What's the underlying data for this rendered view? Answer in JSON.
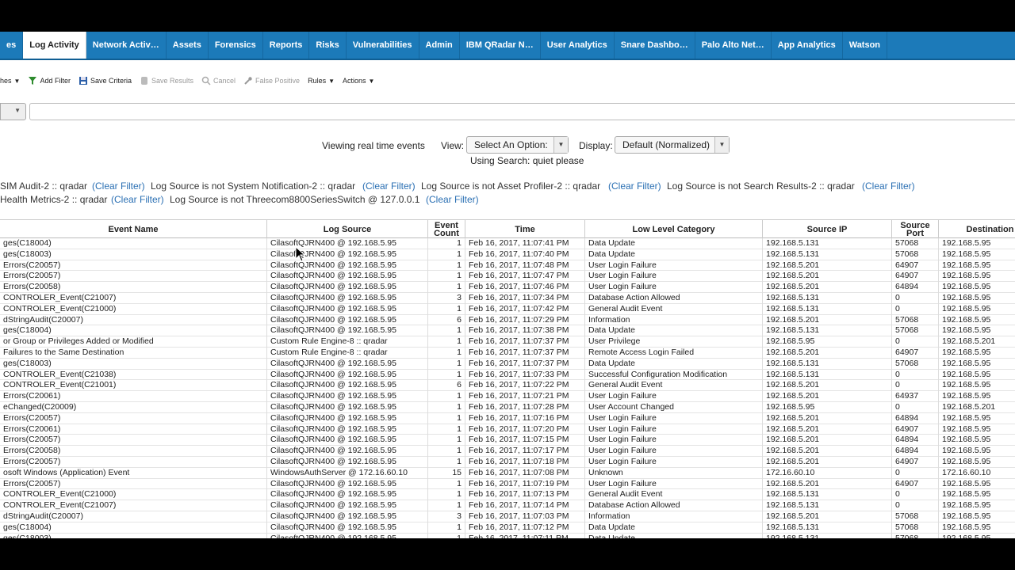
{
  "tabs": [
    {
      "label": "es",
      "active": false
    },
    {
      "label": "Log Activity",
      "active": true
    },
    {
      "label": "Network Activ…",
      "active": false
    },
    {
      "label": "Assets",
      "active": false
    },
    {
      "label": "Forensics",
      "active": false
    },
    {
      "label": "Reports",
      "active": false
    },
    {
      "label": "Risks",
      "active": false
    },
    {
      "label": "Vulnerabilities",
      "active": false
    },
    {
      "label": "Admin",
      "active": false
    },
    {
      "label": "IBM QRadar N…",
      "active": false
    },
    {
      "label": "User Analytics",
      "active": false
    },
    {
      "label": "Snare Dashbo…",
      "active": false
    },
    {
      "label": "Palo Alto Net…",
      "active": false
    },
    {
      "label": "App Analytics",
      "active": false
    },
    {
      "label": "Watson",
      "active": false
    }
  ],
  "toolbar": {
    "searches": "hes",
    "add_filter": "Add Filter",
    "save_criteria": "Save Criteria",
    "save_results": "Save Results",
    "cancel": "Cancel",
    "false_positive": "False Positive",
    "rules": "Rules",
    "actions": "Actions"
  },
  "search": {
    "value": ""
  },
  "view_bar": {
    "viewing": "Viewing real time events",
    "view_label": "View:",
    "view_value": "Select An Option:",
    "display_label": "Display:",
    "display_value": "Default (Normalized)",
    "using_search": "Using Search: quiet please"
  },
  "filters": {
    "row1": [
      {
        "text": "SIM Audit-2 :: qradar"
      },
      {
        "text": "(Clear Filter)"
      },
      {
        "text": "Log Source is not System Notification-2 :: qradar"
      },
      {
        "text": "(Clear Filter)"
      },
      {
        "text": "Log Source is not Asset Profiler-2 :: qradar"
      },
      {
        "text": "(Clear Filter)"
      },
      {
        "text": "Log Source is not Search Results-2 :: qradar"
      },
      {
        "text": "(Clear Filter)"
      }
    ],
    "row2": [
      {
        "text": "Health Metrics-2 :: qradar"
      },
      {
        "text": "(Clear Filter)"
      },
      {
        "text": "Log Source is not Threecom8800SeriesSwitch @ 127.0.0.1"
      },
      {
        "text": "(Clear Filter)"
      }
    ]
  },
  "table": {
    "headers": {
      "event_name": "Event Name",
      "log_source": "Log Source",
      "event_count": "Event Count",
      "time": "Time",
      "category": "Low Level Category",
      "source_ip": "Source IP",
      "source_port": "Source Port",
      "destination": "Destination"
    },
    "rows": [
      {
        "name": "ges(C18004)",
        "src": "CilasoftQJRN400 @ 192.168.5.95",
        "count": "1",
        "time": "Feb 16, 2017, 11:07:41 PM",
        "cat": "Data Update",
        "ip": "192.168.5.131",
        "port": "57068",
        "dst": "192.168.5.95"
      },
      {
        "name": "ges(C18003)",
        "src": "CilasoftQJRN400 @ 192.168.5.95",
        "count": "1",
        "time": "Feb 16, 2017, 11:07:40 PM",
        "cat": "Data Update",
        "ip": "192.168.5.131",
        "port": "57068",
        "dst": "192.168.5.95"
      },
      {
        "name": "Errors(C20057)",
        "src": "CilasoftQJRN400 @ 192.168.5.95",
        "count": "1",
        "time": "Feb 16, 2017, 11:07:48 PM",
        "cat": "User Login Failure",
        "ip": "192.168.5.201",
        "port": "64907",
        "dst": "192.168.5.95"
      },
      {
        "name": "Errors(C20057)",
        "src": "CilasoftQJRN400 @ 192.168.5.95",
        "count": "1",
        "time": "Feb 16, 2017, 11:07:47 PM",
        "cat": "User Login Failure",
        "ip": "192.168.5.201",
        "port": "64907",
        "dst": "192.168.5.95"
      },
      {
        "name": "Errors(C20058)",
        "src": "CilasoftQJRN400 @ 192.168.5.95",
        "count": "1",
        "time": "Feb 16, 2017, 11:07:46 PM",
        "cat": "User Login Failure",
        "ip": "192.168.5.201",
        "port": "64894",
        "dst": "192.168.5.95"
      },
      {
        "name": "CONTROLER_Event(C21007)",
        "src": "CilasoftQJRN400 @ 192.168.5.95",
        "count": "3",
        "time": "Feb 16, 2017, 11:07:34 PM",
        "cat": "Database Action Allowed",
        "ip": "192.168.5.131",
        "port": "0",
        "dst": "192.168.5.95"
      },
      {
        "name": "CONTROLER_Event(C21000)",
        "src": "CilasoftQJRN400 @ 192.168.5.95",
        "count": "1",
        "time": "Feb 16, 2017, 11:07:42 PM",
        "cat": "General Audit Event",
        "ip": "192.168.5.131",
        "port": "0",
        "dst": "192.168.5.95"
      },
      {
        "name": "dStringAudit(C20007)",
        "src": "CilasoftQJRN400 @ 192.168.5.95",
        "count": "6",
        "time": "Feb 16, 2017, 11:07:29 PM",
        "cat": "Information",
        "ip": "192.168.5.201",
        "port": "57068",
        "dst": "192.168.5.95"
      },
      {
        "name": "ges(C18004)",
        "src": "CilasoftQJRN400 @ 192.168.5.95",
        "count": "1",
        "time": "Feb 16, 2017, 11:07:38 PM",
        "cat": "Data Update",
        "ip": "192.168.5.131",
        "port": "57068",
        "dst": "192.168.5.95"
      },
      {
        "name": "or Group or Privileges Added or Modified",
        "src": "Custom Rule Engine-8 :: qradar",
        "count": "1",
        "time": "Feb 16, 2017, 11:07:37 PM",
        "cat": "User Privilege",
        "ip": "192.168.5.95",
        "port": "0",
        "dst": "192.168.5.201"
      },
      {
        "name": "Failures to the Same Destination",
        "src": "Custom Rule Engine-8 :: qradar",
        "count": "1",
        "time": "Feb 16, 2017, 11:07:37 PM",
        "cat": "Remote Access Login Failed",
        "ip": "192.168.5.201",
        "port": "64907",
        "dst": "192.168.5.95"
      },
      {
        "name": "ges(C18003)",
        "src": "CilasoftQJRN400 @ 192.168.5.95",
        "count": "1",
        "time": "Feb 16, 2017, 11:07:37 PM",
        "cat": "Data Update",
        "ip": "192.168.5.131",
        "port": "57068",
        "dst": "192.168.5.95"
      },
      {
        "name": "CONTROLER_Event(C21038)",
        "src": "CilasoftQJRN400 @ 192.168.5.95",
        "count": "1",
        "time": "Feb 16, 2017, 11:07:33 PM",
        "cat": "Successful Configuration Modification",
        "ip": "192.168.5.131",
        "port": "0",
        "dst": "192.168.5.95"
      },
      {
        "name": "CONTROLER_Event(C21001)",
        "src": "CilasoftQJRN400 @ 192.168.5.95",
        "count": "6",
        "time": "Feb 16, 2017, 11:07:22 PM",
        "cat": "General Audit Event",
        "ip": "192.168.5.201",
        "port": "0",
        "dst": "192.168.5.95"
      },
      {
        "name": "Errors(C20061)",
        "src": "CilasoftQJRN400 @ 192.168.5.95",
        "count": "1",
        "time": "Feb 16, 2017, 11:07:21 PM",
        "cat": "User Login Failure",
        "ip": "192.168.5.201",
        "port": "64937",
        "dst": "192.168.5.95"
      },
      {
        "name": "eChanged(C20009)",
        "src": "CilasoftQJRN400 @ 192.168.5.95",
        "count": "1",
        "time": "Feb 16, 2017, 11:07:28 PM",
        "cat": "User Account Changed",
        "ip": "192.168.5.95",
        "port": "0",
        "dst": "192.168.5.201"
      },
      {
        "name": "Errors(C20057)",
        "src": "CilasoftQJRN400 @ 192.168.5.95",
        "count": "1",
        "time": "Feb 16, 2017, 11:07:16 PM",
        "cat": "User Login Failure",
        "ip": "192.168.5.201",
        "port": "64894",
        "dst": "192.168.5.95"
      },
      {
        "name": "Errors(C20061)",
        "src": "CilasoftQJRN400 @ 192.168.5.95",
        "count": "1",
        "time": "Feb 16, 2017, 11:07:20 PM",
        "cat": "User Login Failure",
        "ip": "192.168.5.201",
        "port": "64907",
        "dst": "192.168.5.95"
      },
      {
        "name": "Errors(C20057)",
        "src": "CilasoftQJRN400 @ 192.168.5.95",
        "count": "1",
        "time": "Feb 16, 2017, 11:07:15 PM",
        "cat": "User Login Failure",
        "ip": "192.168.5.201",
        "port": "64894",
        "dst": "192.168.5.95"
      },
      {
        "name": "Errors(C20058)",
        "src": "CilasoftQJRN400 @ 192.168.5.95",
        "count": "1",
        "time": "Feb 16, 2017, 11:07:17 PM",
        "cat": "User Login Failure",
        "ip": "192.168.5.201",
        "port": "64894",
        "dst": "192.168.5.95"
      },
      {
        "name": "Errors(C20057)",
        "src": "CilasoftQJRN400 @ 192.168.5.95",
        "count": "1",
        "time": "Feb 16, 2017, 11:07:18 PM",
        "cat": "User Login Failure",
        "ip": "192.168.5.201",
        "port": "64907",
        "dst": "192.168.5.95"
      },
      {
        "name": "osoft Windows (Application) Event",
        "src": "WindowsAuthServer @ 172.16.60.10",
        "count": "15",
        "time": "Feb 16, 2017, 11:07:08 PM",
        "cat": "Unknown",
        "ip": "172.16.60.10",
        "port": "0",
        "dst": "172.16.60.10"
      },
      {
        "name": "Errors(C20057)",
        "src": "CilasoftQJRN400 @ 192.168.5.95",
        "count": "1",
        "time": "Feb 16, 2017, 11:07:19 PM",
        "cat": "User Login Failure",
        "ip": "192.168.5.201",
        "port": "64907",
        "dst": "192.168.5.95"
      },
      {
        "name": "CONTROLER_Event(C21000)",
        "src": "CilasoftQJRN400 @ 192.168.5.95",
        "count": "1",
        "time": "Feb 16, 2017, 11:07:13 PM",
        "cat": "General Audit Event",
        "ip": "192.168.5.131",
        "port": "0",
        "dst": "192.168.5.95"
      },
      {
        "name": "CONTROLER_Event(C21007)",
        "src": "CilasoftQJRN400 @ 192.168.5.95",
        "count": "1",
        "time": "Feb 16, 2017, 11:07:14 PM",
        "cat": "Database Action Allowed",
        "ip": "192.168.5.131",
        "port": "0",
        "dst": "192.168.5.95"
      },
      {
        "name": "dStringAudit(C20007)",
        "src": "CilasoftQJRN400 @ 192.168.5.95",
        "count": "3",
        "time": "Feb 16, 2017, 11:07:03 PM",
        "cat": "Information",
        "ip": "192.168.5.201",
        "port": "57068",
        "dst": "192.168.5.95"
      },
      {
        "name": "ges(C18004)",
        "src": "CilasoftQJRN400 @ 192.168.5.95",
        "count": "1",
        "time": "Feb 16, 2017, 11:07:12 PM",
        "cat": "Data Update",
        "ip": "192.168.5.131",
        "port": "57068",
        "dst": "192.168.5.95"
      },
      {
        "name": "ges(C18003)",
        "src": "CilasoftQJRN400 @ 192.168.5.95",
        "count": "1",
        "time": "Feb 16, 2017, 11:07:11 PM",
        "cat": "Data Update",
        "ip": "192.168.5.131",
        "port": "57068",
        "dst": "192.168.5.95"
      }
    ]
  }
}
